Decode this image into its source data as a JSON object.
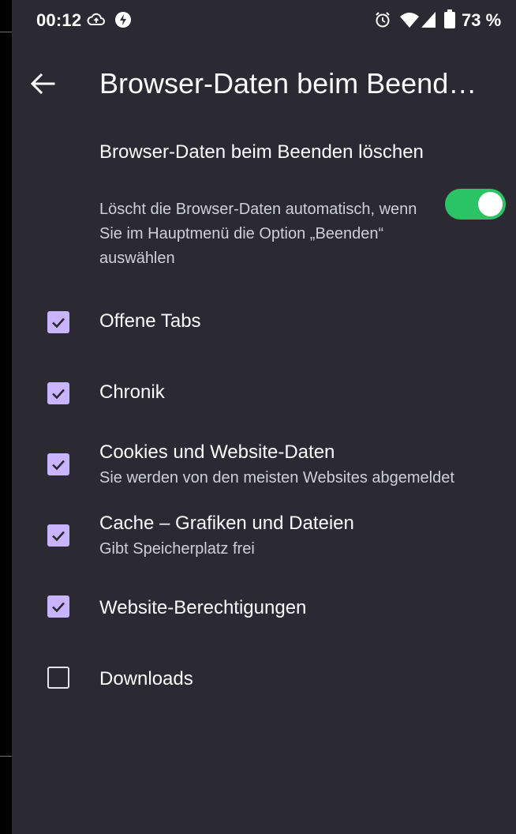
{
  "status_bar": {
    "time": "00:12",
    "battery_text": "73 %",
    "icons": [
      "cloud-upload-icon",
      "flash-icon",
      "alarm-icon",
      "wifi-icon",
      "signal-icon",
      "battery-icon"
    ]
  },
  "app_bar": {
    "back_icon": "arrow-back-icon",
    "title": "Browser-Daten beim Beend…"
  },
  "main_setting": {
    "title": "Browser-Daten beim Beenden löschen",
    "summary": "Löscht die Browser-Daten automatisch, wenn Sie im Hauptmenü die Option „Beenden“ auswählen",
    "enabled": true
  },
  "items": [
    {
      "label": "Offene Tabs",
      "summary": "",
      "checked": true
    },
    {
      "label": "Chronik",
      "summary": "",
      "checked": true
    },
    {
      "label": "Cookies und Website-Daten",
      "summary": "Sie werden von den meisten Websites abgemeldet",
      "checked": true
    },
    {
      "label": "Cache – Grafiken und Dateien",
      "summary": "Gibt Speicherplatz frei",
      "checked": true
    },
    {
      "label": "Website-Berechtigungen",
      "summary": "",
      "checked": true
    },
    {
      "label": "Downloads",
      "summary": "",
      "checked": false
    }
  ],
  "colors": {
    "background": "#2b2a33",
    "checkbox_accent": "#c9b5ff",
    "switch_on": "#2ac365"
  }
}
